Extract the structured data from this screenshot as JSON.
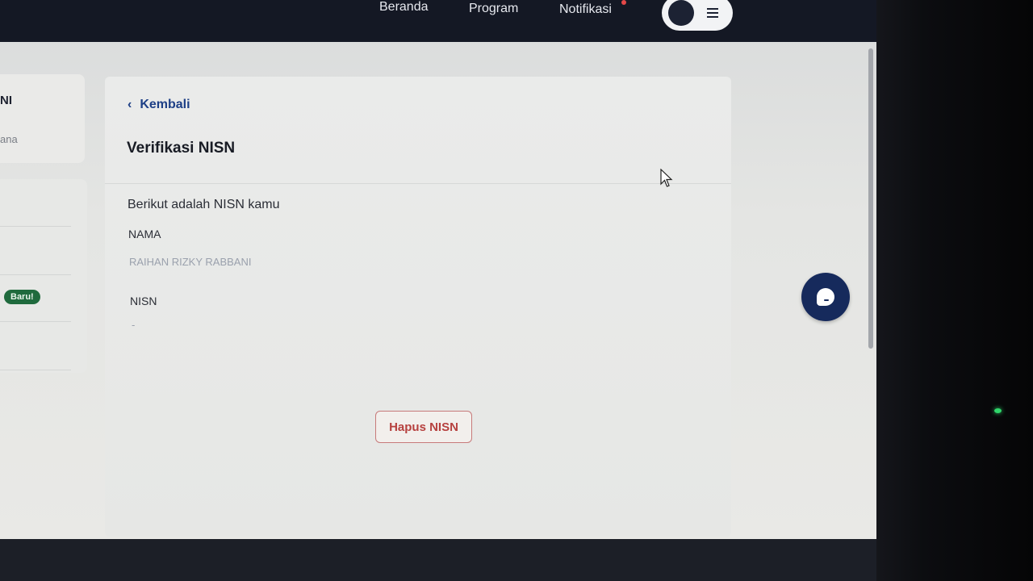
{
  "topbar": {
    "nav_items": [
      {
        "label": "Beranda"
      },
      {
        "label": "Program"
      },
      {
        "label": "Notifikasi"
      }
    ]
  },
  "sidebar": {
    "card_title_partial": "NI",
    "card_subtitle_partial": "ana",
    "badge": "Baru!"
  },
  "main": {
    "back_label": "Kembali",
    "title": "Verifikasi NISN",
    "intro": "Berikut adalah NISN kamu",
    "nama_label": "NAMA",
    "nama_value": "RAIHAN RIZKY RABBANI",
    "nisn_label": "NISN",
    "nisn_value": "-",
    "delete_button": "Hapus NISN"
  },
  "icons": {
    "back": "chevron-left-icon",
    "menu": "hamburger-menu-icon",
    "chat": "chat-bubble-icon",
    "cursor": "mouse-pointer-icon"
  },
  "colors": {
    "navbar_bg": "#141824",
    "link_blue": "#1d3f86",
    "danger_red": "#b6413f",
    "badge_green": "#1f6a3d",
    "fab_navy": "#162a5c"
  }
}
